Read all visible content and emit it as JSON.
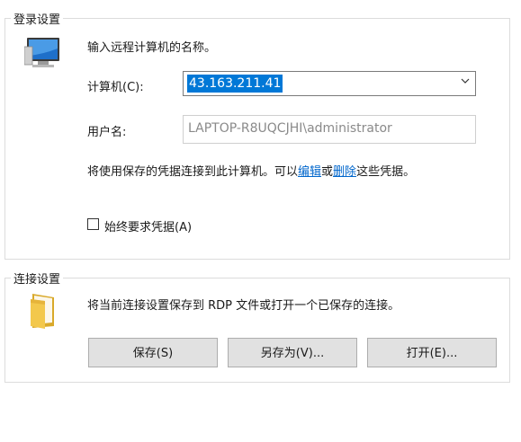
{
  "login_group": {
    "legend": "登录设置",
    "instruction": "输入远程计算机的名称。",
    "computer_label": "计算机(C):",
    "computer_value": "43.163.211.41",
    "username_label": "用户名:",
    "username_value": "LAPTOP-R8UQCJHI\\administrator",
    "credentials_text_pre": "将使用保存的凭据连接到此计算机。可以",
    "edit_link": "编辑",
    "or_text": "或",
    "delete_link": "删除",
    "credentials_text_post": "这些凭据。",
    "always_ask_label": "始终要求凭据(A)",
    "always_ask_checked": false,
    "icon": "computer-monitor-icon"
  },
  "connection_group": {
    "legend": "连接设置",
    "description": "将当前连接设置保存到 RDP 文件或打开一个已保存的连接。",
    "save_button": "保存(S)",
    "save_as_button": "另存为(V)...",
    "open_button": "打开(E)...",
    "icon": "folder-icon"
  },
  "colors": {
    "selection": "#0078d7",
    "link": "#0066cc",
    "button_face": "#e1e1e1"
  }
}
